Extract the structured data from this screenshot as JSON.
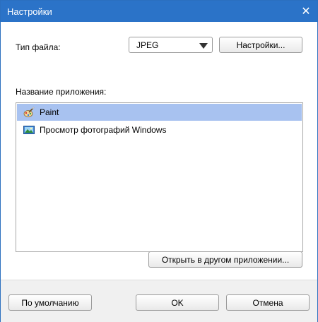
{
  "window": {
    "title": "Настройки"
  },
  "file_type": {
    "label": "Тип файла:",
    "selected": "JPEG",
    "settings_button": "Настройки..."
  },
  "apps": {
    "label": "Название приложения:",
    "items": [
      {
        "label": "Paint",
        "icon": "paint-icon",
        "selected": true
      },
      {
        "label": "Просмотр фотографий Windows",
        "icon": "photo-viewer-icon",
        "selected": false
      }
    ],
    "open_other_button": "Открыть в другом приложении..."
  },
  "footer": {
    "default_button": "По умолчанию",
    "ok_button": "OK",
    "cancel_button": "Отмена"
  },
  "colors": {
    "titlebar": "#2b73c8",
    "selection": "#a8c2f0",
    "footer": "#f0f0f0"
  }
}
